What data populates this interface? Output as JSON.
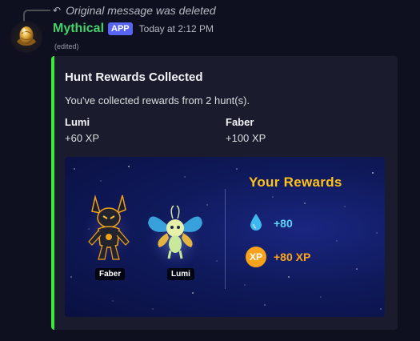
{
  "reply": {
    "text": "Original message was deleted",
    "icon": "reply-arrow-icon"
  },
  "message": {
    "username": "Mythical",
    "badge": "APP",
    "timestamp": "Today at 2:12 PM",
    "edited": "(edited)",
    "avatar_icon": "golden-egg-icon"
  },
  "colors": {
    "username": "#43d26a",
    "badge": "#5865f2",
    "embed_bar": "#3ee83a",
    "rewards_title": "#ffc21a",
    "drop_value": "#5fd3f7",
    "xp": "#f7a21b"
  },
  "embed": {
    "title": "Hunt Rewards Collected",
    "description": "You've collected rewards from 2 hunt(s).",
    "fields": [
      {
        "name": "Lumi",
        "value": "+60 XP"
      },
      {
        "name": "Faber",
        "value": "+100 XP"
      }
    ],
    "image": {
      "creatures": [
        {
          "name": "Faber",
          "icon": "faber-creature-icon"
        },
        {
          "name": "Lumi",
          "icon": "lumi-creature-icon"
        }
      ],
      "rewards_title": "Your Rewards",
      "rewards": [
        {
          "icon": "water-drop-icon",
          "value": "+80"
        },
        {
          "icon": "xp-badge-icon",
          "badge": "XP",
          "value": "+80 XP"
        }
      ]
    }
  }
}
